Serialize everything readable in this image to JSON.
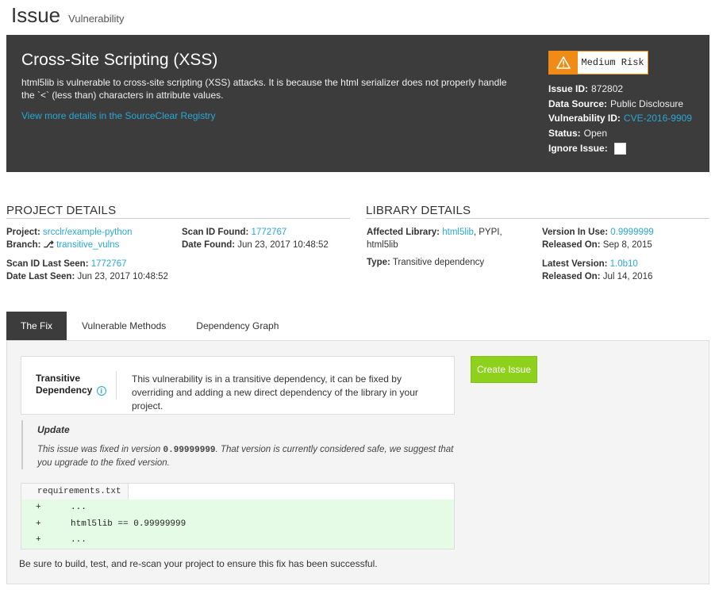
{
  "header": {
    "title": "Issue",
    "subtitle": "Vulnerability"
  },
  "vulnerability": {
    "title": "Cross-Site Scripting (XSS)",
    "description": "html5lib is vulnerable to cross-site scripting (XSS) attacks. It is because the html serializer does not properly handle the `<` (less than) characters in attribute values.",
    "registry_link": "View more details in the SourceClear Registry",
    "risk_label": "Medium Risk",
    "risk_color": "#f08c16",
    "meta": {
      "issue_id_label": "Issue ID:",
      "issue_id": "872802",
      "data_source_label": "Data Source:",
      "data_source": "Public Disclosure",
      "vuln_id_label": "Vulnerability ID:",
      "vuln_id": "CVE-2016-9909",
      "status_label": "Status:",
      "status": "Open",
      "ignore_label": "Ignore Issue:"
    }
  },
  "project_details": {
    "heading": "PROJECT DETAILS",
    "project_label": "Project:",
    "project": "srcclr/example-python",
    "branch_label": "Branch:",
    "branch": "transitive_vulns",
    "scan_id_found_label": "Scan ID Found:",
    "scan_id_found": "1772767",
    "date_found_label": "Date Found:",
    "date_found": "Jun 23, 2017 10:48:52",
    "scan_id_last_seen_label": "Scan ID Last Seen:",
    "scan_id_last_seen": "1772767",
    "date_last_seen_label": "Date Last Seen:",
    "date_last_seen": "Jun 23, 2017 10:48:52"
  },
  "library_details": {
    "heading": "LIBRARY DETAILS",
    "affected_label": "Affected Library:",
    "affected_link": "html5lib",
    "affected_rest": ", PYPI,",
    "affected_line2": "html5lib",
    "type_label": "Type:",
    "type": "Transitive dependency",
    "version_in_use_label": "Version In Use:",
    "version_in_use": "0.9999999",
    "released_on_label": "Released On:",
    "released_on": "Sep 8, 2015",
    "latest_version_label": "Latest Version:",
    "latest_version": "1.0b10",
    "latest_released_label": "Released On:",
    "latest_released": "Jul 14, 2016"
  },
  "tabs": [
    {
      "label": "The Fix"
    },
    {
      "label": "Vulnerable Methods"
    },
    {
      "label": "Dependency Graph"
    }
  ],
  "fix": {
    "dep_title_1": "Transitive",
    "dep_title_2": "Dependency",
    "dep_text": "This vulnerability is in a transitive dependency, it can be fixed by overriding and adding a new direct dependency of the library in your project.",
    "create_button": "Create Issue",
    "update_title": "Update",
    "update_pre": "This issue was fixed in version ",
    "update_version": "0.99999999",
    "update_post": ". That version is currently considered safe, we suggest that you upgrade to the fixed version.",
    "file_name": "requirements.txt",
    "code_lines": [
      {
        "sign": "+",
        "text": "..."
      },
      {
        "sign": "+",
        "text": "html5lib == 0.99999999"
      },
      {
        "sign": "+",
        "text": "..."
      }
    ],
    "note": "Be sure to build, test, and re-scan your project to ensure this fix has been successful."
  }
}
